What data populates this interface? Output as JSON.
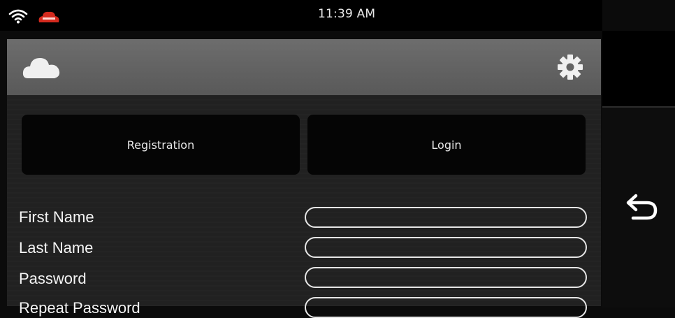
{
  "status_bar": {
    "time": "11:39 AM"
  },
  "tabs": {
    "registration": "Registration",
    "login": "Login"
  },
  "form": {
    "fields": [
      {
        "label": "First Name",
        "value": ""
      },
      {
        "label": "Last Name",
        "value": ""
      },
      {
        "label": "Password",
        "value": ""
      },
      {
        "label": "Repeat Password",
        "value": ""
      }
    ]
  },
  "colors": {
    "app_bar": "#6d6d6d",
    "panel": "#212121",
    "tab_bg": "#050505",
    "status_badge": "#d42a1e"
  },
  "icons": [
    "wifi-icon",
    "status-badge-icon",
    "cloud-icon",
    "gear-icon",
    "back-arrow-icon"
  ]
}
